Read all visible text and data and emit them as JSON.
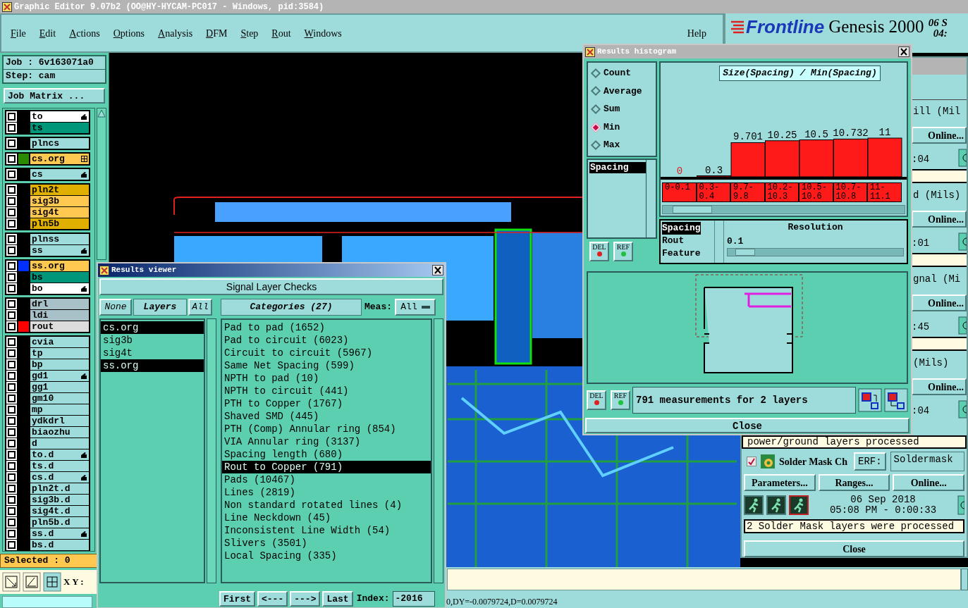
{
  "window": {
    "title": "Graphic Editor 9.07b2 (OO@HY-HYCAM-PC017 - Windows, pid:3584)"
  },
  "menu": [
    "File",
    "Edit",
    "Actions",
    "Options",
    "Analysis",
    "DFM",
    "Step",
    "Rout",
    "Windows"
  ],
  "help": "Help",
  "branding": {
    "logo": "Frontline",
    "product": "Genesis 2000",
    "date": "06 S",
    "time": "04:"
  },
  "job": {
    "job": "Job : 6v163071a0",
    "step": "Step: cam",
    "matrix_button": "Job Matrix ..."
  },
  "layer_groups": [
    [
      {
        "name": "to",
        "color": "#ffffff",
        "kind": "hand",
        "checked": false
      },
      {
        "name": "ts",
        "color": "#00967a",
        "kind": "plain",
        "checked": false
      }
    ],
    [
      {
        "name": "plncs",
        "color": "#9edcdc",
        "kind": "plain",
        "checked": false
      }
    ],
    [
      {
        "name": "cs.org",
        "color": "#ffc850",
        "swatch": {
          "color": "#2a8a00"
        },
        "kind": "grid",
        "checked": false
      }
    ],
    [
      {
        "name": "cs",
        "color": "#9edcdc",
        "kind": "hand",
        "checked": false
      }
    ],
    [
      {
        "name": "pln2t",
        "color": "#e0b000",
        "kind": "plain",
        "checked": false
      },
      {
        "name": "sig3b",
        "color": "#ffc850",
        "kind": "plain",
        "checked": false
      },
      {
        "name": "sig4t",
        "color": "#ffc850",
        "kind": "plain",
        "checked": false
      },
      {
        "name": "pln5b",
        "color": "#e0b000",
        "kind": "plain",
        "checked": false
      }
    ],
    [
      {
        "name": "plnss",
        "color": "#9edcdc",
        "kind": "plain",
        "checked": false
      },
      {
        "name": "ss",
        "color": "#9edcdc",
        "kind": "hand",
        "checked": false
      }
    ],
    [
      {
        "name": "ss.org",
        "color": "#ffc850",
        "swatch": {
          "color": "#0030ff"
        },
        "kind": "plain",
        "checked": false
      },
      {
        "name": "bs",
        "color": "#00967a",
        "kind": "plain",
        "checked": false
      },
      {
        "name": "bo",
        "color": "#ffffff",
        "kind": "hand",
        "checked": false
      }
    ],
    [
      {
        "name": "drl",
        "color": "#a8c0c8",
        "kind": "plain",
        "checked": false
      },
      {
        "name": "ldi",
        "color": "#a8c0c8",
        "kind": "plain",
        "checked": false
      },
      {
        "name": "rout",
        "color": "#dcdcdc",
        "swatch": {
          "color": "#ff0000"
        },
        "kind": "plain",
        "checked": false
      }
    ],
    [
      {
        "name": "cvia",
        "color": "#9edcdc",
        "kind": "plain",
        "checked": false
      },
      {
        "name": "tp",
        "color": "#9edcdc",
        "kind": "plain",
        "checked": false
      },
      {
        "name": "bp",
        "color": "#9edcdc",
        "kind": "plain",
        "checked": false
      },
      {
        "name": "gd1",
        "color": "#9edcdc",
        "kind": "hand",
        "checked": false
      },
      {
        "name": "gg1",
        "color": "#9edcdc",
        "kind": "plain",
        "checked": false
      },
      {
        "name": "gm10",
        "color": "#9edcdc",
        "kind": "plain",
        "checked": false
      },
      {
        "name": "mp",
        "color": "#9edcdc",
        "kind": "plain",
        "checked": false
      },
      {
        "name": "ydkdrl",
        "color": "#9edcdc",
        "kind": "plain",
        "checked": false
      },
      {
        "name": "biaozhu",
        "color": "#9edcdc",
        "kind": "plain",
        "checked": false
      },
      {
        "name": "d",
        "color": "#9edcdc",
        "kind": "plain",
        "checked": false
      },
      {
        "name": "to.d",
        "color": "#9edcdc",
        "kind": "hand",
        "checked": false
      },
      {
        "name": "ts.d",
        "color": "#9edcdc",
        "kind": "plain",
        "checked": false
      },
      {
        "name": "cs.d",
        "color": "#9edcdc",
        "kind": "hand",
        "checked": false
      },
      {
        "name": "pln2t.d",
        "color": "#9edcdc",
        "kind": "plain",
        "checked": false
      },
      {
        "name": "sig3b.d",
        "color": "#9edcdc",
        "kind": "plain",
        "checked": false
      },
      {
        "name": "sig4t.d",
        "color": "#9edcdc",
        "kind": "plain",
        "checked": false
      },
      {
        "name": "pln5b.d",
        "color": "#9edcdc",
        "kind": "plain",
        "checked": false
      },
      {
        "name": "ss.d",
        "color": "#9edcdc",
        "kind": "hand",
        "checked": false
      },
      {
        "name": "bs.d",
        "color": "#9edcdc",
        "kind": "plain",
        "checked": false
      }
    ]
  ],
  "selected_count": "Selected : 0",
  "coord_label": "X Y :",
  "status_text": "0,DY=-0.0079724,D=0.0079724",
  "results_viewer": {
    "title": "Results viewer",
    "check_button": "Signal Layer Checks",
    "none_button": "None",
    "layers_label": "Layers",
    "all_button": "All",
    "categories_label": "Categories (27)",
    "meas_label": "Meas:",
    "meas_value": "All",
    "layers": [
      {
        "name": "cs.org",
        "selected": true
      },
      {
        "name": "sig3b",
        "selected": false
      },
      {
        "name": "sig4t",
        "selected": false
      },
      {
        "name": "ss.org",
        "selected": true
      }
    ],
    "categories": [
      {
        "name": "Pad to pad (1652)",
        "selected": false
      },
      {
        "name": "Pad to circuit (6023)",
        "selected": false
      },
      {
        "name": "Circuit to circuit (5967)",
        "selected": false
      },
      {
        "name": "Same Net Spacing (599)",
        "selected": false
      },
      {
        "name": "NPTH to pad (10)",
        "selected": false
      },
      {
        "name": "NPTH to circuit (441)",
        "selected": false
      },
      {
        "name": "PTH to Copper (1767)",
        "selected": false
      },
      {
        "name": "Shaved SMD (445)",
        "selected": false
      },
      {
        "name": "PTH (Comp) Annular ring (854)",
        "selected": false
      },
      {
        "name": "VIA Annular ring (3137)",
        "selected": false
      },
      {
        "name": "Spacing length (680)",
        "selected": false
      },
      {
        "name": "Rout to Copper (791)",
        "selected": true
      },
      {
        "name": "Pads (10467)",
        "selected": false
      },
      {
        "name": "Lines (2819)",
        "selected": false
      },
      {
        "name": "Non standard rotated lines (4)",
        "selected": false
      },
      {
        "name": "Line Neckdown (45)",
        "selected": false
      },
      {
        "name": "Inconsistent Line Width (54)",
        "selected": false
      },
      {
        "name": "Slivers (3501)",
        "selected": false
      },
      {
        "name": "Local Spacing (335)",
        "selected": false
      }
    ],
    "nav_buttons": [
      "First",
      "<---",
      "--->",
      "Last"
    ],
    "index_label": "Index:",
    "index_value": "-2016"
  },
  "histogram": {
    "title": "Results histogram",
    "modes": [
      {
        "label": "Count",
        "selected": false
      },
      {
        "label": "Average",
        "selected": false
      },
      {
        "label": "Sum",
        "selected": false
      },
      {
        "label": "Min",
        "selected": true
      },
      {
        "label": "Max",
        "selected": false
      }
    ],
    "measures": [
      {
        "name": "Spacing",
        "selected": true
      }
    ],
    "measure_buttons": [
      "DEL",
      "REF"
    ],
    "chart_data": {
      "type": "bar",
      "title": "Size(Spacing) / Min(Spacing)",
      "categories": [
        "0-0.1",
        "0.3-0.4",
        "9.7-9.8",
        "10.2-10.3",
        "10.5-10.6",
        "10.7-10.8",
        "11-11.1"
      ],
      "values": [
        0,
        0.3,
        9.701,
        10.25,
        10.5,
        10.732,
        11
      ],
      "data_labels": true
    },
    "attributes": [
      {
        "name": "Spacing",
        "selected": true
      },
      {
        "name": "Rout",
        "selected": false
      },
      {
        "name": "Feature",
        "selected": false
      }
    ],
    "resolution": {
      "label": "Resolution",
      "value": "0.1",
      "level": 0.05
    },
    "summary_buttons": [
      "DEL",
      "REF"
    ],
    "summary": "791 measurements for 2 layers",
    "close": "Close"
  },
  "dfm_panel": {
    "partial_rows": [
      {
        "label": "ill (Mil",
        "button": "Online...",
        "time": ":04"
      },
      {
        "label": "d (Mils)",
        "button": "Online...",
        "time": ":01"
      },
      {
        "label": "gnal (Mi",
        "button": "Online...",
        "time": ":45"
      },
      {
        "label": "(Mils)",
        "button": "Online...",
        "time": ":04"
      }
    ],
    "message": "power/ground layers processed",
    "solder_mask": {
      "checked": true,
      "title": "Solder Mask Ch",
      "erf_label": "ERF:",
      "erf_value": "Soldermask",
      "buttons": [
        "Parameters...",
        "Ranges...",
        "Online..."
      ],
      "date": "06 Sep 2018",
      "time": "05:08 PM - 0:00:33",
      "message": "2 Solder Mask layers were processed"
    },
    "close": "Close"
  }
}
